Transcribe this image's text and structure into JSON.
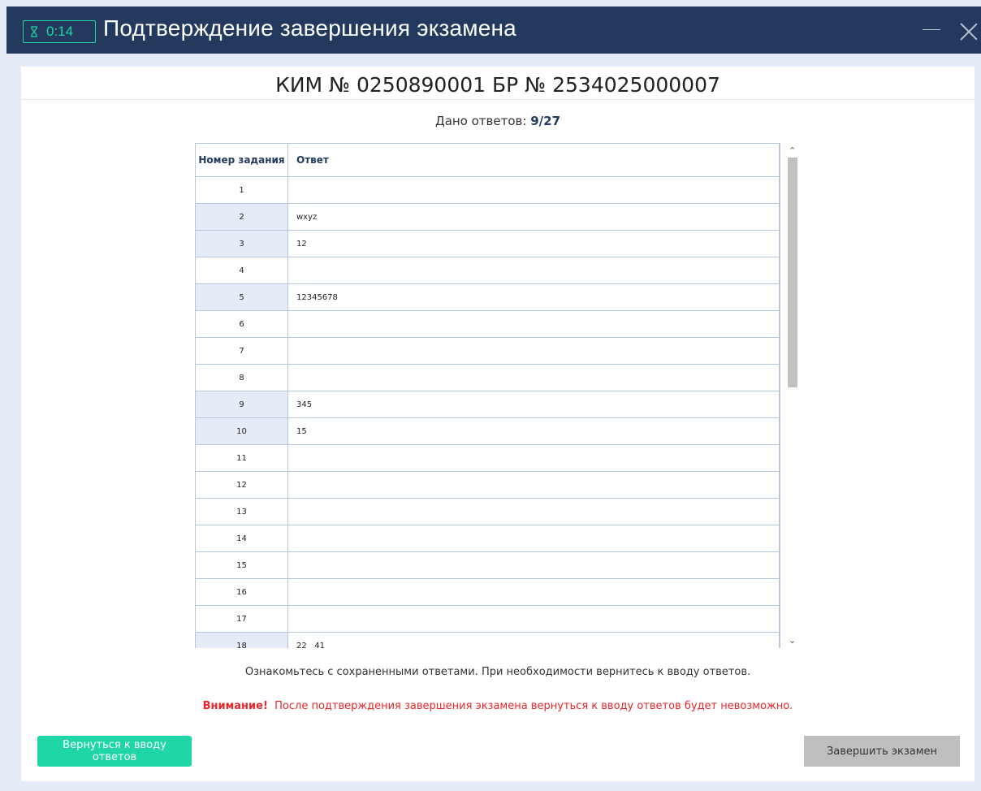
{
  "window": {
    "timer": "0:14",
    "title": "Подтверждение завершения экзамена"
  },
  "header": {
    "kim": "КИМ № 0250890001 БР № 2534025000007",
    "answers_label": "Дано ответов:",
    "answers_count": "9/27"
  },
  "table": {
    "columns": [
      "Номер задания",
      "Ответ"
    ],
    "rows": [
      {
        "num": "1",
        "answer": ""
      },
      {
        "num": "2",
        "answer": "wxyz"
      },
      {
        "num": "3",
        "answer": "12"
      },
      {
        "num": "4",
        "answer": ""
      },
      {
        "num": "5",
        "answer": "12345678"
      },
      {
        "num": "6",
        "answer": ""
      },
      {
        "num": "7",
        "answer": ""
      },
      {
        "num": "8",
        "answer": ""
      },
      {
        "num": "9",
        "answer": "345"
      },
      {
        "num": "10",
        "answer": "15"
      },
      {
        "num": "11",
        "answer": ""
      },
      {
        "num": "12",
        "answer": ""
      },
      {
        "num": "13",
        "answer": ""
      },
      {
        "num": "14",
        "answer": ""
      },
      {
        "num": "15",
        "answer": ""
      },
      {
        "num": "16",
        "answer": ""
      },
      {
        "num": "17",
        "answer": ""
      },
      {
        "num": "18",
        "answer": "22   41"
      }
    ]
  },
  "hint": "Ознакомьтесь с сохраненными ответами. При необходимости вернитесь к вводу ответов.",
  "warning": {
    "label": "Внимание!",
    "text": "После подтверждения завершения экзамена вернуться к вводу ответов будет невозможно."
  },
  "buttons": {
    "back": "Вернуться к вводу ответов",
    "finish": "Завершить экзамен"
  },
  "colors": {
    "titlebar": "#233a5e",
    "accent": "#1fd6a6",
    "warning": "#e8272b"
  }
}
